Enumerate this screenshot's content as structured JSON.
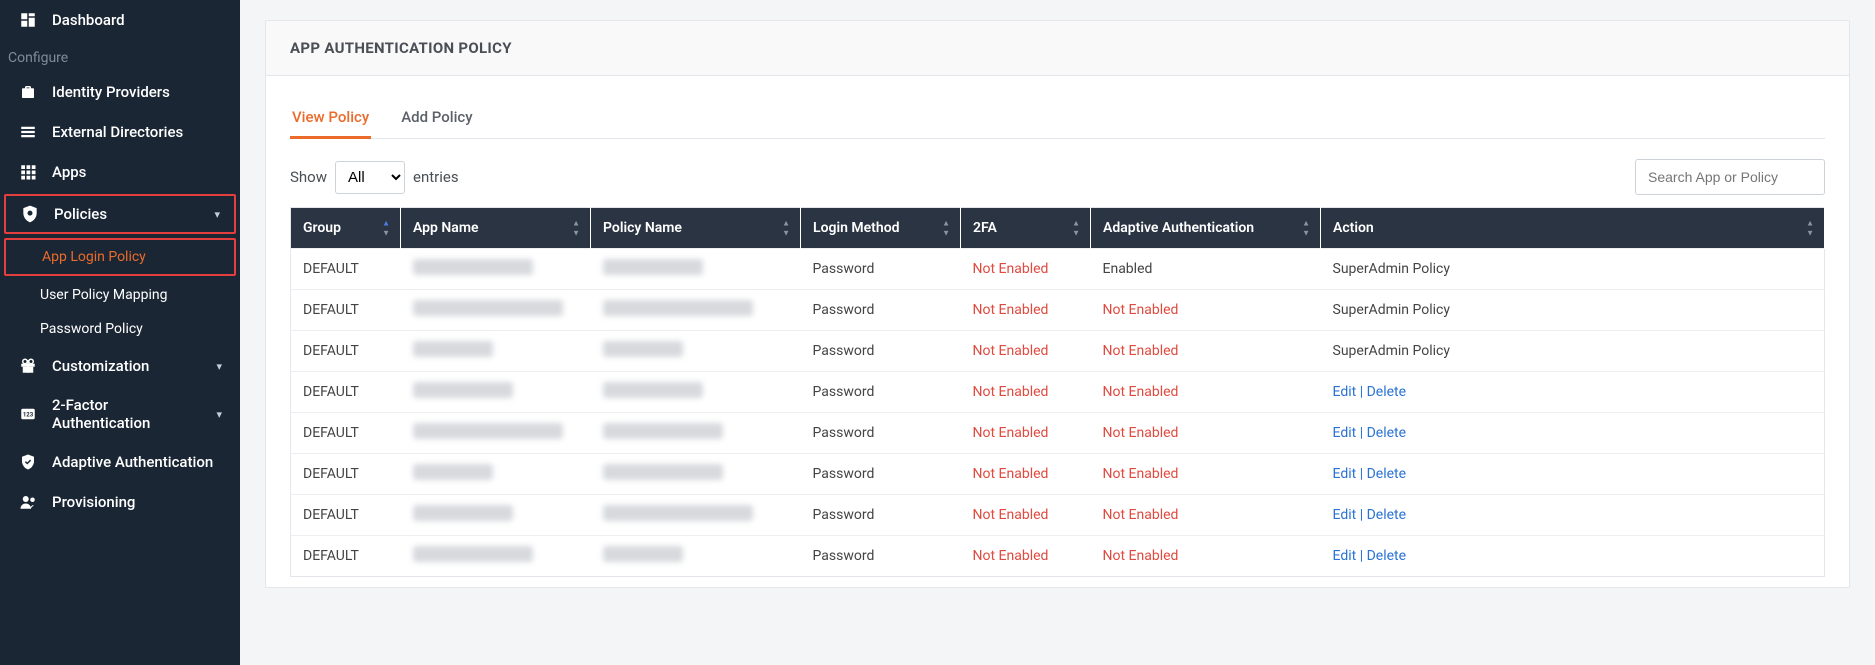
{
  "sidebar": {
    "dashboard": {
      "label": "Dashboard"
    },
    "configure_header": "Configure",
    "identity_providers": {
      "label": "Identity Providers"
    },
    "external_directories": {
      "label": "External Directories"
    },
    "apps": {
      "label": "Apps"
    },
    "policies": {
      "label": "Policies",
      "submenu": {
        "app_login_policy": {
          "label": "App Login Policy"
        },
        "user_policy_mapping": {
          "label": "User Policy Mapping"
        },
        "password_policy": {
          "label": "Password Policy"
        }
      }
    },
    "customization": {
      "label": "Customization"
    },
    "two_factor": {
      "label": "2-Factor Authentication"
    },
    "adaptive_auth": {
      "label": "Adaptive Authentication"
    },
    "provisioning": {
      "label": "Provisioning"
    }
  },
  "panel": {
    "title": "APP AUTHENTICATION POLICY"
  },
  "tabs": [
    {
      "label": "View Policy",
      "active": true
    },
    {
      "label": "Add Policy",
      "active": false
    }
  ],
  "entries_control": {
    "show_label": "Show",
    "entries_label": "entries",
    "options": [
      "All"
    ],
    "selected": "All"
  },
  "search": {
    "placeholder": "Search App or Policy"
  },
  "table": {
    "headers": {
      "group": "Group",
      "app_name": "App Name",
      "policy_name": "Policy Name",
      "login_method": "Login Method",
      "two_fa": "2FA",
      "adaptive_auth": "Adaptive Authentication",
      "action": "Action"
    },
    "row_labels": {
      "edit": "Edit",
      "delete": "Delete"
    },
    "rows": [
      {
        "group": "DEFAULT",
        "login_method": "Password",
        "two_fa": "Not Enabled",
        "adaptive": "Enabled",
        "action_type": "text",
        "action_text": "SuperAdmin Policy"
      },
      {
        "group": "DEFAULT",
        "login_method": "Password",
        "two_fa": "Not Enabled",
        "adaptive": "Not Enabled",
        "action_type": "text",
        "action_text": "SuperAdmin Policy"
      },
      {
        "group": "DEFAULT",
        "login_method": "Password",
        "two_fa": "Not Enabled",
        "adaptive": "Not Enabled",
        "action_type": "text",
        "action_text": "SuperAdmin Policy"
      },
      {
        "group": "DEFAULT",
        "login_method": "Password",
        "two_fa": "Not Enabled",
        "adaptive": "Not Enabled",
        "action_type": "links"
      },
      {
        "group": "DEFAULT",
        "login_method": "Password",
        "two_fa": "Not Enabled",
        "adaptive": "Not Enabled",
        "action_type": "links"
      },
      {
        "group": "DEFAULT",
        "login_method": "Password",
        "two_fa": "Not Enabled",
        "adaptive": "Not Enabled",
        "action_type": "links"
      },
      {
        "group": "DEFAULT",
        "login_method": "Password",
        "two_fa": "Not Enabled",
        "adaptive": "Not Enabled",
        "action_type": "links"
      },
      {
        "group": "DEFAULT",
        "login_method": "Password",
        "two_fa": "Not Enabled",
        "adaptive": "Not Enabled",
        "action_type": "links"
      }
    ]
  }
}
